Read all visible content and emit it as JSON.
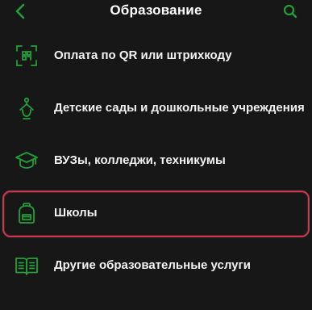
{
  "header": {
    "title": "Образование",
    "back_icon": "chevron-left-icon",
    "search_icon": "search-icon"
  },
  "colors": {
    "accent": "#21a038",
    "background": "#171717",
    "highlight": "#c23b52"
  },
  "items": [
    {
      "label": "Оплата по QR или штрихкоду",
      "icon": "qr-scan-icon"
    },
    {
      "label": "Детские сады и дошкольные учреждения",
      "icon": "kindergarten-icon"
    },
    {
      "label": "ВУЗы, колледжи, техникумы",
      "icon": "graduation-cap-icon"
    },
    {
      "label": "Школы",
      "icon": "backpack-icon",
      "highlighted": true
    },
    {
      "label": "Другие образовательные услуги",
      "icon": "open-book-icon"
    }
  ]
}
